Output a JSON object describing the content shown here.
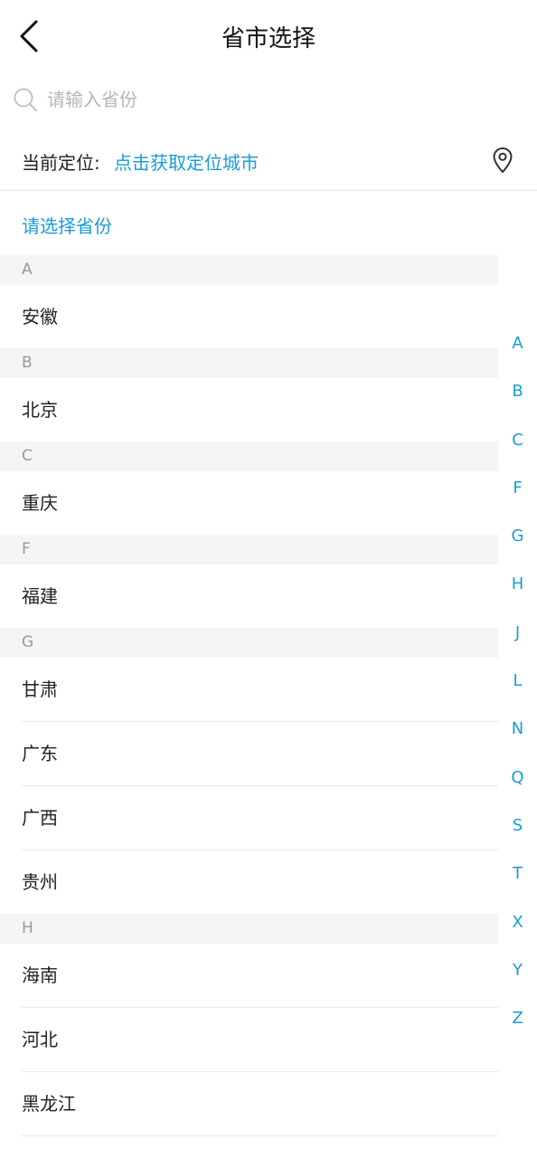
{
  "header": {
    "title": "省市选择",
    "back_icon": "chevron-left-icon"
  },
  "search": {
    "placeholder": "请输入省份",
    "value": ""
  },
  "location": {
    "label": "当前定位:",
    "link": "点击获取定位城市",
    "icon": "map-pin-icon"
  },
  "prompt": "请选择省份",
  "accent_color": "#1a9bd7",
  "sections": [
    {
      "letter": "A",
      "items": [
        "安徽"
      ]
    },
    {
      "letter": "B",
      "items": [
        "北京"
      ]
    },
    {
      "letter": "C",
      "items": [
        "重庆"
      ]
    },
    {
      "letter": "F",
      "items": [
        "福建"
      ]
    },
    {
      "letter": "G",
      "items": [
        "甘肃",
        "广东",
        "广西",
        "贵州"
      ]
    },
    {
      "letter": "H",
      "items": [
        "海南",
        "河北",
        "黑龙江"
      ]
    }
  ],
  "index": [
    "A",
    "B",
    "C",
    "F",
    "G",
    "H",
    "J",
    "L",
    "N",
    "Q",
    "S",
    "T",
    "X",
    "Y",
    "Z"
  ]
}
